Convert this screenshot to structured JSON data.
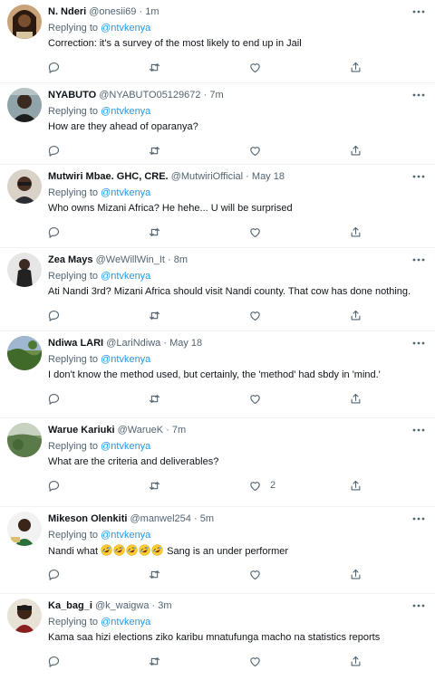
{
  "replying_label": "Replying to",
  "tweets": [
    {
      "name": "N. Nderi",
      "handle": "@onesii69",
      "dot": "·",
      "time": "1m",
      "replying_to": "@ntvkenya",
      "text": "Correction: it's a survey of the most likely to end up in Jail",
      "likes": ""
    },
    {
      "name": "NYABUTO",
      "handle": "@NYABUTO05129672",
      "dot": "·",
      "time": "7m",
      "replying_to": "@ntvkenya",
      "text": "How are they ahead of oparanya?",
      "likes": ""
    },
    {
      "name": "Mutwiri Mbae. GHC, CRE.",
      "handle": "@MutwiriOfficial",
      "dot": "·",
      "time": "May 18",
      "replying_to": "@ntvkenya",
      "text": "Who owns Mizani Africa? He hehe... U will be surprised",
      "likes": ""
    },
    {
      "name": "Zea Mays",
      "handle": "@WeWillWin_It",
      "dot": "·",
      "time": "8m",
      "replying_to": "@ntvkenya",
      "text": "Ati Nandi 3rd? Mizani Africa should visit Nandi county. That cow has done nothing.",
      "likes": ""
    },
    {
      "name": "Ndiwa LARI",
      "handle": "@LariNdiwa",
      "dot": "·",
      "time": "May 18",
      "replying_to": "@ntvkenya",
      "text": "I don't know the method used, but certainly, the 'method' had sbdy in 'mind.'",
      "likes": ""
    },
    {
      "name": "Warue Kariuki",
      "handle": "@WarueK",
      "dot": "·",
      "time": "7m",
      "replying_to": "@ntvkenya",
      "text": "What are the criteria and deliverables?",
      "likes": "2"
    },
    {
      "name": "Mikeson Olenkiti",
      "handle": "@manwel254",
      "dot": "·",
      "time": "5m",
      "replying_to": "@ntvkenya",
      "text_before": "Nandi what",
      "text_after": "Sang is an under performer",
      "emoji_count": 5,
      "likes": ""
    },
    {
      "name": "Ka_bag_i",
      "handle": "@k_waigwa",
      "dot": "·",
      "time": "3m",
      "replying_to": "@ntvkenya",
      "text": "Kama saa hizi elections ziko karibu mnatufunga macho na statistics reports",
      "likes": ""
    }
  ]
}
